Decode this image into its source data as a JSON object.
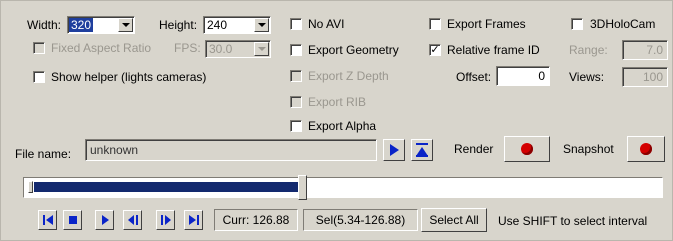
{
  "resolution": {
    "width_label": "Width:",
    "width_value": "320",
    "height_label": "Height:",
    "height_value": "240",
    "fixed_aspect_label": "Fixed Aspect Ratio",
    "fps_label": "FPS:",
    "fps_value": "30.0",
    "show_helper_label": "Show helper (lights cameras)"
  },
  "options": {
    "no_avi": "No AVI",
    "export_geometry": "Export Geometry",
    "export_z_depth": "Export Z Depth",
    "export_rib": "Export RIB",
    "export_alpha": "Export Alpha"
  },
  "frames": {
    "export_frames": "Export Frames",
    "relative_frame_id": "Relative frame ID",
    "relative_frame_checked": true,
    "offset_label": "Offset:",
    "offset_value": "0"
  },
  "holocam": {
    "label": "3DHoloCam",
    "range_label": "Range:",
    "range_value": "7.0",
    "views_label": "Views:",
    "views_value": "100"
  },
  "file": {
    "label": "File name:",
    "value": "unknown",
    "render_label": "Render",
    "snapshot_label": "Snapshot"
  },
  "timeline": {
    "progress_fraction": 0.43
  },
  "status": {
    "current": "Curr: 126.88",
    "selection": "Sel(5.34-126.88)",
    "select_all_label": "Select All",
    "hint": "Use SHIFT to select interval"
  },
  "colors": {
    "accent_blue": "#0a24c8",
    "record_red": "#d40000",
    "panel_bg": "#d8d5cc"
  }
}
